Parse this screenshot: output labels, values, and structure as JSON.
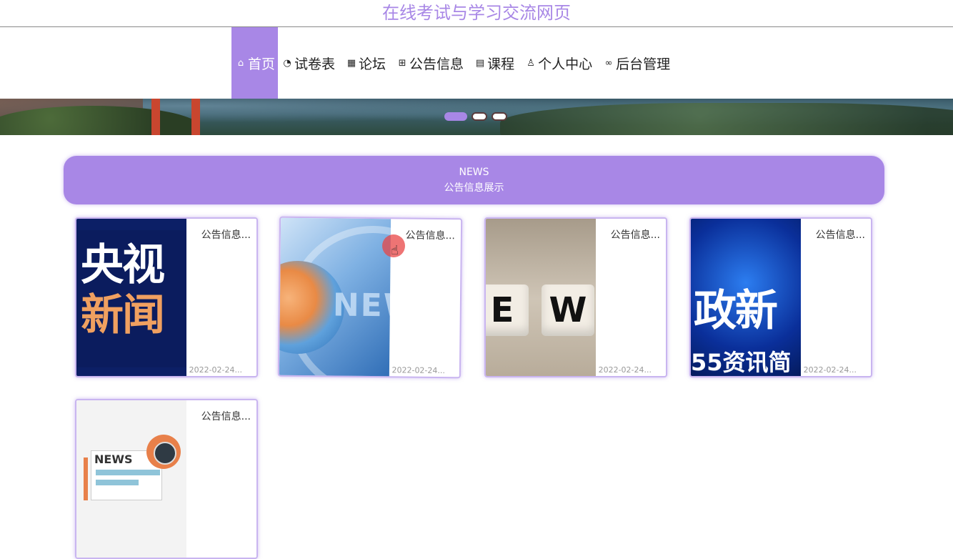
{
  "site": {
    "title": "在线考试与学习交流网页"
  },
  "nav": {
    "items": [
      {
        "label": "首页",
        "icon": "home-icon",
        "glyph": "⌂",
        "active": true
      },
      {
        "label": "试卷表",
        "icon": "gauge-icon",
        "glyph": "◔",
        "active": false
      },
      {
        "label": "论坛",
        "icon": "forum-icon",
        "glyph": "▦",
        "active": false
      },
      {
        "label": "公告信息",
        "icon": "notice-icon",
        "glyph": "⊞",
        "active": false
      },
      {
        "label": "课程",
        "icon": "course-icon",
        "glyph": "▤",
        "active": false
      },
      {
        "label": "个人中心",
        "icon": "user-icon",
        "glyph": "♙",
        "active": false
      },
      {
        "label": "后台管理",
        "icon": "link-icon",
        "glyph": "∞",
        "active": false
      }
    ]
  },
  "banner": {
    "slides": 3,
    "active_slide": 1
  },
  "section": {
    "title_en": "NEWS",
    "title_cn": "公告信息展示"
  },
  "cards": [
    {
      "title": "公告信息...",
      "date": "2022-02-24...",
      "thumb_text_1": "央视",
      "thumb_text_2": "新闻"
    },
    {
      "title": "公告信息...",
      "date": "2022-02-24...",
      "thumb_text_1": "NEWS"
    },
    {
      "title": "公告信息...",
      "date": "2022-02-24...",
      "thumb_text_1": "E",
      "thumb_text_2": "W"
    },
    {
      "title": "公告信息...",
      "date": "2022-02-24...",
      "thumb_text_1": "政新",
      "thumb_text_2": "55资讯简"
    },
    {
      "title": "公告信息...",
      "thumb_text_1": "NEWS"
    }
  ],
  "colors": {
    "accent": "#a887e6",
    "title": "#a887e6",
    "cursor_highlight": "#e84646"
  }
}
